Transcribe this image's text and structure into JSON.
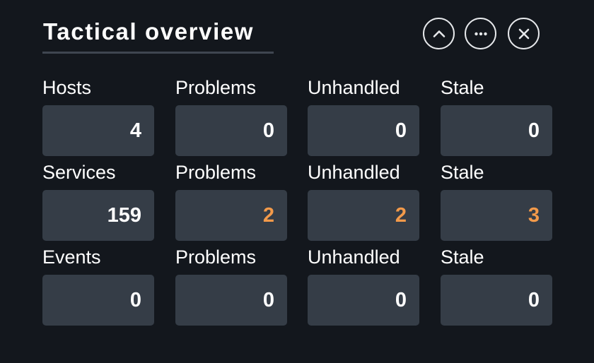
{
  "header": {
    "title": "Tactical overview"
  },
  "controls": {
    "collapse_icon": "chevron-up-icon",
    "more_icon": "more-horizontal-icon",
    "close_icon": "close-icon"
  },
  "rows": [
    {
      "labels": [
        "Hosts",
        "Problems",
        "Unhandled",
        "Stale"
      ],
      "values": [
        "4",
        "0",
        "0",
        "0"
      ]
    },
    {
      "labels": [
        "Services",
        "Problems",
        "Unhandled",
        "Stale"
      ],
      "values": [
        "159",
        "2",
        "2",
        "3"
      ]
    },
    {
      "labels": [
        "Events",
        "Problems",
        "Unhandled",
        "Stale"
      ],
      "values": [
        "0",
        "0",
        "0",
        "0"
      ]
    }
  ],
  "colors": {
    "background": "#13171d",
    "tile": "#353d47",
    "text": "#ffffff",
    "warning": "#f39a4a"
  }
}
